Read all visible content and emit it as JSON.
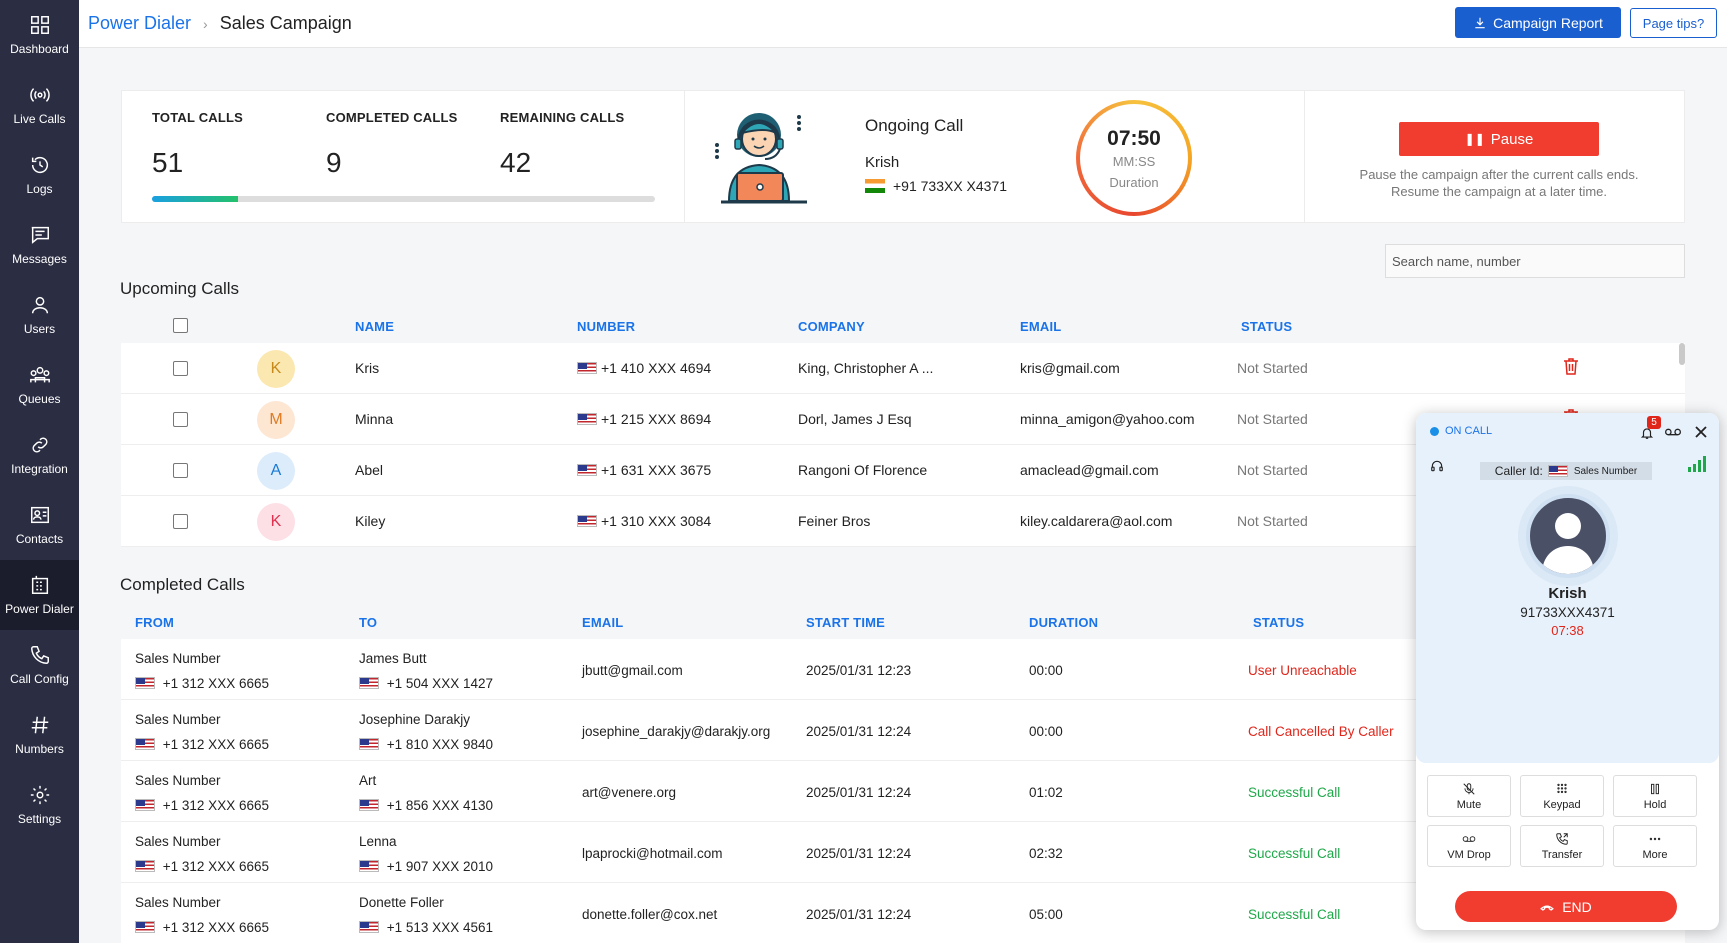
{
  "sidebar": {
    "items": [
      {
        "label": "Dashboard"
      },
      {
        "label": "Live Calls"
      },
      {
        "label": "Logs"
      },
      {
        "label": "Messages"
      },
      {
        "label": "Users"
      },
      {
        "label": "Queues"
      },
      {
        "label": "Integration"
      },
      {
        "label": "Contacts"
      },
      {
        "label": "Power Dialer"
      },
      {
        "label": "Call Config"
      },
      {
        "label": "Numbers"
      },
      {
        "label": "Settings"
      }
    ],
    "active": "Power Dialer"
  },
  "header": {
    "breadcrumb_root": "Power Dialer",
    "breadcrumb_current": "Sales Campaign",
    "report_button": "Campaign Report",
    "tips_button": "Page tips?"
  },
  "stats": {
    "total_label": "TOTAL CALLS",
    "total_value": "51",
    "completed_label": "COMPLETED CALLS",
    "completed_value": "9",
    "remaining_label": "REMAINING CALLS",
    "remaining_value": "42",
    "progress_fraction": 0.17
  },
  "ongoing": {
    "title": "Ongoing Call",
    "name": "Krish",
    "number": "+91 733XX X4371",
    "timer": "07:50",
    "timer_format": "MM:SS",
    "timer_label": "Duration"
  },
  "pause": {
    "button": "Pause",
    "note_line1": "Pause the campaign after the current calls ends.",
    "note_line2": "Resume the campaign at a later time."
  },
  "search": {
    "placeholder": "Search name, number"
  },
  "upcoming": {
    "title": "Upcoming Calls",
    "columns": [
      "NAME",
      "NUMBER",
      "COMPANY",
      "EMAIL",
      "STATUS"
    ],
    "rows": [
      {
        "initial": "K",
        "name": "Kris",
        "number": "+1 410 XXX 4694",
        "company": "King, Christopher A ...",
        "email": "kris@gmail.com",
        "status": "Not Started",
        "avatar_bg": "#fbe7b0",
        "avatar_fg": "#c78a1a"
      },
      {
        "initial": "M",
        "name": "Minna",
        "number": "+1 215 XXX 8694",
        "company": "Dorl, James J Esq",
        "email": "minna_amigon@yahoo.com",
        "status": "Not Started",
        "avatar_bg": "#fde6d2",
        "avatar_fg": "#e07b22"
      },
      {
        "initial": "A",
        "name": "Abel",
        "number": "+1 631 XXX 3675",
        "company": "Rangoni Of Florence",
        "email": "amaclead@gmail.com",
        "status": "Not Started",
        "avatar_bg": "#dcecfb",
        "avatar_fg": "#1a7ad6"
      },
      {
        "initial": "K",
        "name": "Kiley",
        "number": "+1 310 XXX 3084",
        "company": "Feiner Bros",
        "email": "kiley.caldarera@aol.com",
        "status": "Not Started",
        "avatar_bg": "#fde0e6",
        "avatar_fg": "#e0314f"
      }
    ]
  },
  "completed": {
    "title": "Completed Calls",
    "columns": [
      "FROM",
      "TO",
      "EMAIL",
      "START TIME",
      "DURATION",
      "STATUS"
    ],
    "rows": [
      {
        "from_name": "Sales Number",
        "from_number": "+1 312 XXX 6665",
        "to_name": "James Butt",
        "to_number": "+1 504 XXX 1427",
        "email": "jbutt@gmail.com",
        "start": "2025/01/31 12:23",
        "duration": "00:00",
        "status": "User Unreachable",
        "status_color": "#e0261b"
      },
      {
        "from_name": "Sales Number",
        "from_number": "+1 312 XXX 6665",
        "to_name": "Josephine Darakjy",
        "to_number": "+1 810 XXX 9840",
        "email": "josephine_darakjy@darakjy.org",
        "start": "2025/01/31 12:24",
        "duration": "00:00",
        "status": "Call Cancelled By Caller",
        "status_color": "#e0261b"
      },
      {
        "from_name": "Sales Number",
        "from_number": "+1 312 XXX 6665",
        "to_name": "Art",
        "to_number": "+1 856 XXX 4130",
        "email": "art@venere.org",
        "start": "2025/01/31 12:24",
        "duration": "01:02",
        "status": "Successful Call",
        "status_color": "#1fa84a"
      },
      {
        "from_name": "Sales Number",
        "from_number": "+1 312 XXX 6665",
        "to_name": "Lenna",
        "to_number": "+1 907 XXX 2010",
        "email": "lpaprocki@hotmail.com",
        "start": "2025/01/31 12:24",
        "duration": "02:32",
        "status": "Successful Call",
        "status_color": "#1fa84a"
      },
      {
        "from_name": "Sales Number",
        "from_number": "+1 312 XXX 6665",
        "to_name": "Donette Foller",
        "to_number": "+1 513 XXX 4561",
        "email": "donette.foller@cox.net",
        "start": "2025/01/31 12:24",
        "duration": "05:00",
        "status": "Successful Call",
        "status_color": "#1fa84a"
      }
    ]
  },
  "softphone": {
    "status": "ON CALL",
    "notification_count": "5",
    "caller_id_label": "Caller Id:",
    "caller_id_value": "Sales Number",
    "name": "Krish",
    "number": "91733XXX4371",
    "elapsed": "07:38",
    "buttons": [
      "Mute",
      "Keypad",
      "Hold",
      "VM Drop",
      "Transfer",
      "More"
    ],
    "end_button": "END"
  },
  "colors": {
    "sidebar": "#2b2d42",
    "primary": "#1a5fd0",
    "danger": "#f13c30",
    "success": "#1fa84a"
  }
}
